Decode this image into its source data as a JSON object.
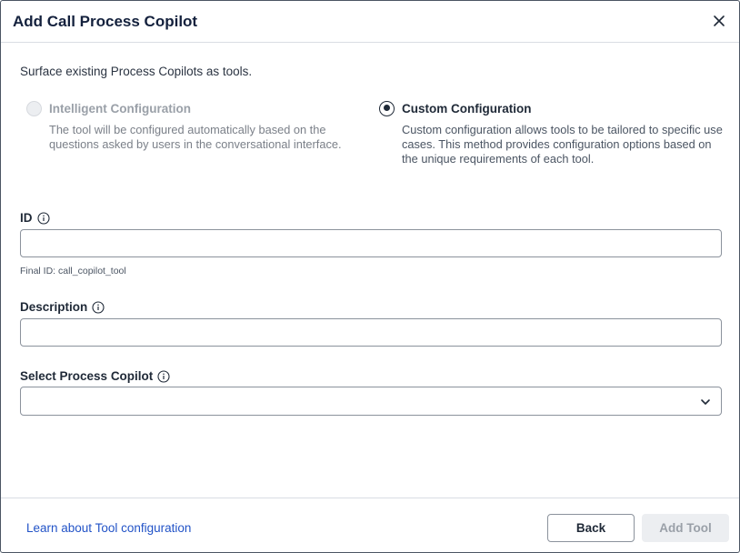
{
  "dialog": {
    "title": "Add Call Process Copilot",
    "intro": "Surface existing Process Copilots as tools."
  },
  "options": {
    "intelligent": {
      "label": "Intelligent Configuration",
      "description": "The tool will be configured automatically based on the questions asked by users in the conversational interface.",
      "state": "disabled"
    },
    "custom": {
      "label": "Custom Configuration",
      "description": "Custom configuration allows tools to be tailored to specific use cases. This method provides configuration options based on the unique requirements of each tool.",
      "state": "selected"
    }
  },
  "fields": {
    "id": {
      "label": "ID",
      "value": "",
      "hint": "Final ID: call_copilot_tool"
    },
    "description": {
      "label": "Description",
      "value": ""
    },
    "copilot": {
      "label": "Select Process Copilot",
      "value": ""
    }
  },
  "footer": {
    "link": "Learn about Tool configuration",
    "back_label": "Back",
    "add_label": "Add Tool"
  },
  "icons": {
    "close": "close-icon",
    "info": "info-icon",
    "chevron": "chevron-down-icon"
  },
  "colors": {
    "title": "#14213d",
    "link": "#2253c7",
    "disabled_text": "#9aa0a8"
  }
}
